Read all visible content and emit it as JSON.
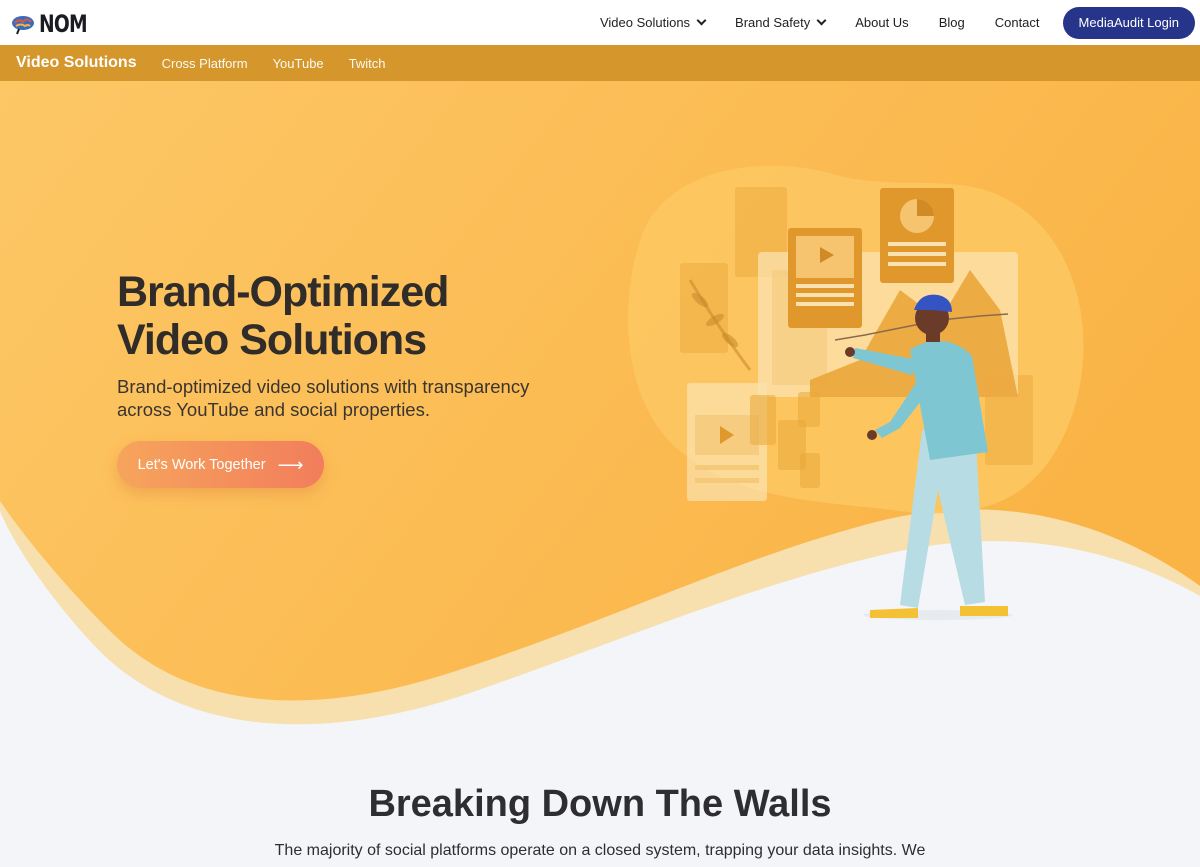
{
  "brand": {
    "logo_text": "NOM",
    "logo_icon": "brain-icon"
  },
  "nav": {
    "items": [
      {
        "label": "Video Solutions",
        "dropdown": true
      },
      {
        "label": "Brand Safety",
        "dropdown": true
      },
      {
        "label": "About Us",
        "dropdown": false
      },
      {
        "label": "Blog",
        "dropdown": false
      },
      {
        "label": "Contact",
        "dropdown": false
      }
    ],
    "login_label": "MediaAudit Login"
  },
  "subnav": {
    "title": "Video Solutions",
    "items": [
      "Cross Platform",
      "YouTube",
      "Twitch"
    ]
  },
  "hero": {
    "title_line1": "Brand-Optimized",
    "title_line2": "Video Solutions",
    "subtitle": "Brand-optimized video solutions with transparency across YouTube and social properties.",
    "cta_label": "Let's Work Together",
    "cta_icon": "arrow-right-icon"
  },
  "section": {
    "title": "Breaking Down The Walls",
    "text": "The majority of social platforms operate on a closed system, trapping your data insights. We"
  },
  "colors": {
    "brand_navy": "#26348a",
    "subnav_gold": "#d5962c",
    "hero_orange": "#fbbf4f",
    "cta_coral": "#f27d5c"
  }
}
